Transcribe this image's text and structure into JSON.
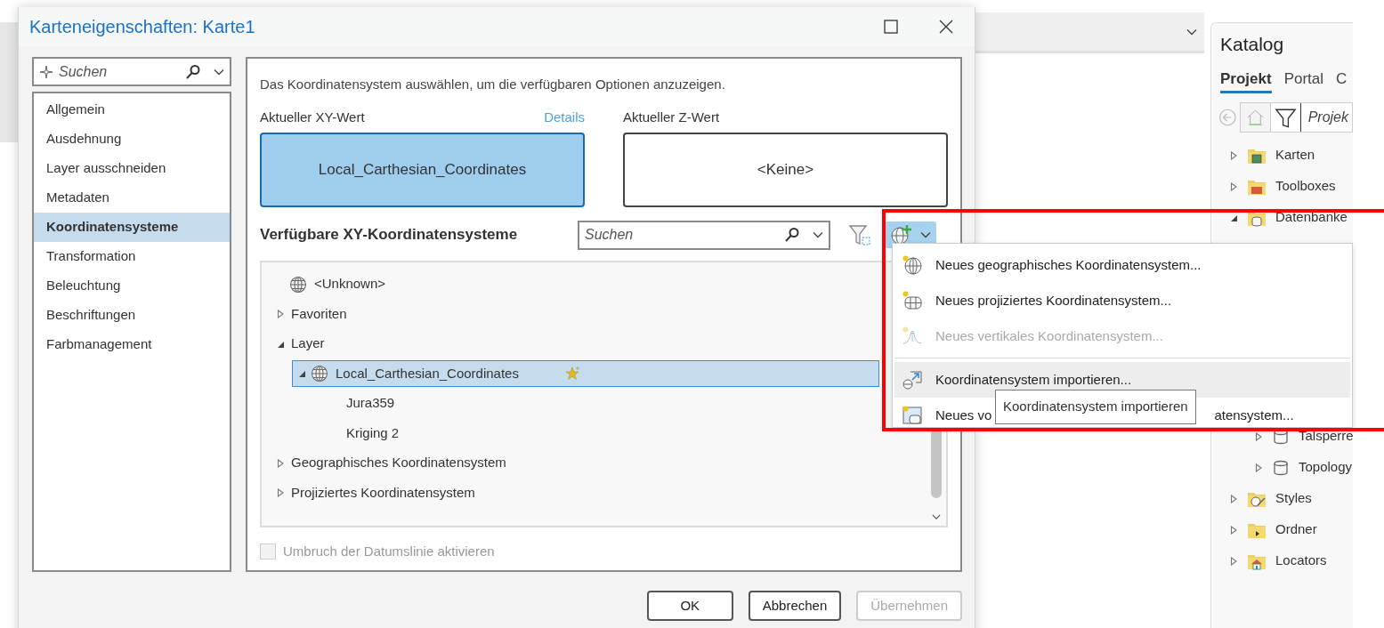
{
  "dialog": {
    "title": "Karteneigenschaften: Karte1",
    "search": {
      "placeholder": "Suchen"
    },
    "nav": [
      {
        "label": "Allgemein",
        "selected": false
      },
      {
        "label": "Ausdehnung",
        "selected": false
      },
      {
        "label": "Layer ausschneiden",
        "selected": false
      },
      {
        "label": "Metadaten",
        "selected": false
      },
      {
        "label": "Koordinatensysteme",
        "selected": true
      },
      {
        "label": "Transformation",
        "selected": false
      },
      {
        "label": "Beleuchtung",
        "selected": false
      },
      {
        "label": "Beschriftungen",
        "selected": false
      },
      {
        "label": "Farbmanagement",
        "selected": false
      }
    ],
    "description": "Das Koordinatensystem auswählen, um die verfügbaren Optionen anzuzeigen.",
    "current_xy": {
      "label": "Aktueller XY-Wert",
      "link": "Details",
      "value": "Local_Carthesian_Coordinates"
    },
    "current_z": {
      "label": "Aktueller Z-Wert",
      "value": "<Keine>"
    },
    "available": {
      "title": "Verfügbare XY-Koordinatensysteme",
      "search": {
        "placeholder": "Suchen"
      },
      "tree": [
        {
          "label": "<Unknown>",
          "kind": "coordinate-system",
          "selected": false
        },
        {
          "label": "Favoriten",
          "expanded": false,
          "selected": false
        },
        {
          "label": "Layer",
          "expanded": true,
          "selected": false,
          "children": [
            {
              "label": "Local_Carthesian_Coordinates",
              "kind": "coordinate-system",
              "expanded": true,
              "selected": true,
              "favorite": true,
              "children": [
                {
                  "label": "Jura359",
                  "selected": false
                },
                {
                  "label": "Kriging 2",
                  "selected": false
                }
              ]
            }
          ]
        },
        {
          "label": "Geographisches Koordinatensystem",
          "expanded": false,
          "selected": false
        },
        {
          "label": "Projiziertes Koordinatensystem",
          "expanded": false,
          "selected": false
        }
      ]
    },
    "wrap_checkbox": {
      "label": "Umbruch der Datumslinie aktivieren",
      "checked": false,
      "disabled": true
    },
    "buttons": [
      {
        "label": "OK",
        "disabled": false
      },
      {
        "label": "Abbrechen",
        "disabled": false
      },
      {
        "label": "Übernehmen",
        "disabled": true
      }
    ]
  },
  "menu": {
    "items": [
      {
        "kind": "geographic",
        "label": "Neues geographisches Koordinatensystem...",
        "disabled": false,
        "hovered": false
      },
      {
        "kind": "projected",
        "label": "Neues projiziertes Koordinatensystem...",
        "disabled": false,
        "hovered": false
      },
      {
        "kind": "vertical",
        "label": "Neues vertikales Koordinatensystem...",
        "disabled": true,
        "hovered": false
      },
      {
        "kind": "separator"
      },
      {
        "kind": "import",
        "label": "Koordinatensystem importieren...",
        "disabled": false,
        "hovered": true
      },
      {
        "kind": "from-view",
        "label": "Neues vo",
        "label_end": "atensystem...",
        "disabled": false,
        "hovered": false
      }
    ]
  },
  "tooltip": "Koordinatensystem importieren",
  "catalog": {
    "title": "Katalog",
    "tabs": [
      {
        "label": "Projekt",
        "selected": true
      },
      {
        "label": "Portal",
        "selected": false
      },
      {
        "label": "C",
        "selected": false
      }
    ],
    "search": {
      "value": "Projek"
    },
    "tree": [
      {
        "label": "Karten",
        "kind": "maps",
        "expanded": false
      },
      {
        "label": "Toolboxes",
        "kind": "toolboxes",
        "expanded": false
      },
      {
        "label": "Datenbanke",
        "kind": "databases",
        "expanded": true,
        "children": [
          {
            "label": "Talsperre",
            "kind": "database",
            "expanded": false
          },
          {
            "label": "Topology",
            "kind": "database",
            "expanded": false
          }
        ]
      },
      {
        "label": "Styles",
        "kind": "styles",
        "expanded": false
      },
      {
        "label": "Ordner",
        "kind": "folder",
        "expanded": false
      },
      {
        "label": "Locators",
        "kind": "locators",
        "expanded": false
      }
    ]
  }
}
